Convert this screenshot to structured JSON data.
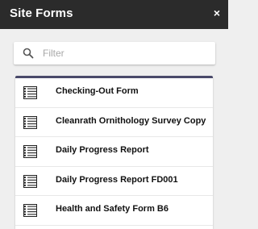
{
  "header": {
    "title": "Site Forms",
    "close_label": "×"
  },
  "search": {
    "placeholder": "Filter",
    "value": ""
  },
  "forms": [
    {
      "label": "Checking-Out Form"
    },
    {
      "label": "Cleanrath Ornithology Survey Copy"
    },
    {
      "label": "Daily Progress Report"
    },
    {
      "label": "Daily Progress Report FD001"
    },
    {
      "label": "Health and Safety Form B6"
    }
  ],
  "colors": {
    "header_bg": "#2b2b2b",
    "page_bg": "#efefef",
    "list_accent": "#4a4a6a"
  }
}
